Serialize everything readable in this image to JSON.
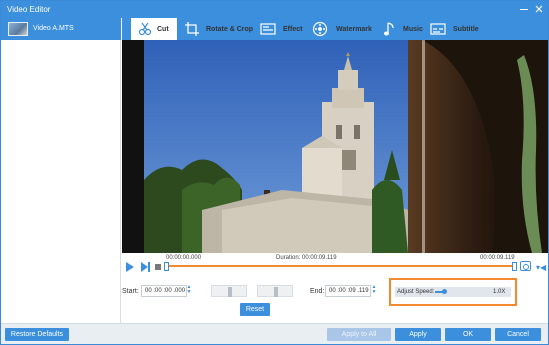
{
  "window": {
    "title": "Video Editor"
  },
  "sidebar": {
    "items": [
      {
        "label": "Video A.MTS"
      }
    ]
  },
  "tabs": [
    {
      "label": "Cut",
      "icon": "scissors-icon",
      "active": true
    },
    {
      "label": "Rotate & Crop",
      "icon": "crop-icon",
      "active": false
    },
    {
      "label": "Effect",
      "icon": "effect-icon",
      "active": false
    },
    {
      "label": "Watermark",
      "icon": "watermark-icon",
      "active": false
    },
    {
      "label": "Music",
      "icon": "music-icon",
      "active": false
    },
    {
      "label": "Subtitle",
      "icon": "subtitle-icon",
      "active": false
    }
  ],
  "timeline": {
    "start_time": "00:00:00.000",
    "duration": "Duration: 00:00:09.119",
    "end_time": "00:00:09.119"
  },
  "cut": {
    "start_label": "Start:",
    "start_value": "00 :00 :00 .000",
    "end_label": "End:",
    "end_value": "00 :00 :09 .119",
    "reset_label": "Reset"
  },
  "speed": {
    "label": "Adjust Speed:",
    "value": "1.0X"
  },
  "footer": {
    "restore_label": "Restore Defaults",
    "apply_all_label": "Apply to All",
    "apply_label": "Apply",
    "ok_label": "OK",
    "cancel_label": "Cancel"
  },
  "colors": {
    "accent": "#3b8fdc",
    "highlight": "#f28a2f"
  }
}
